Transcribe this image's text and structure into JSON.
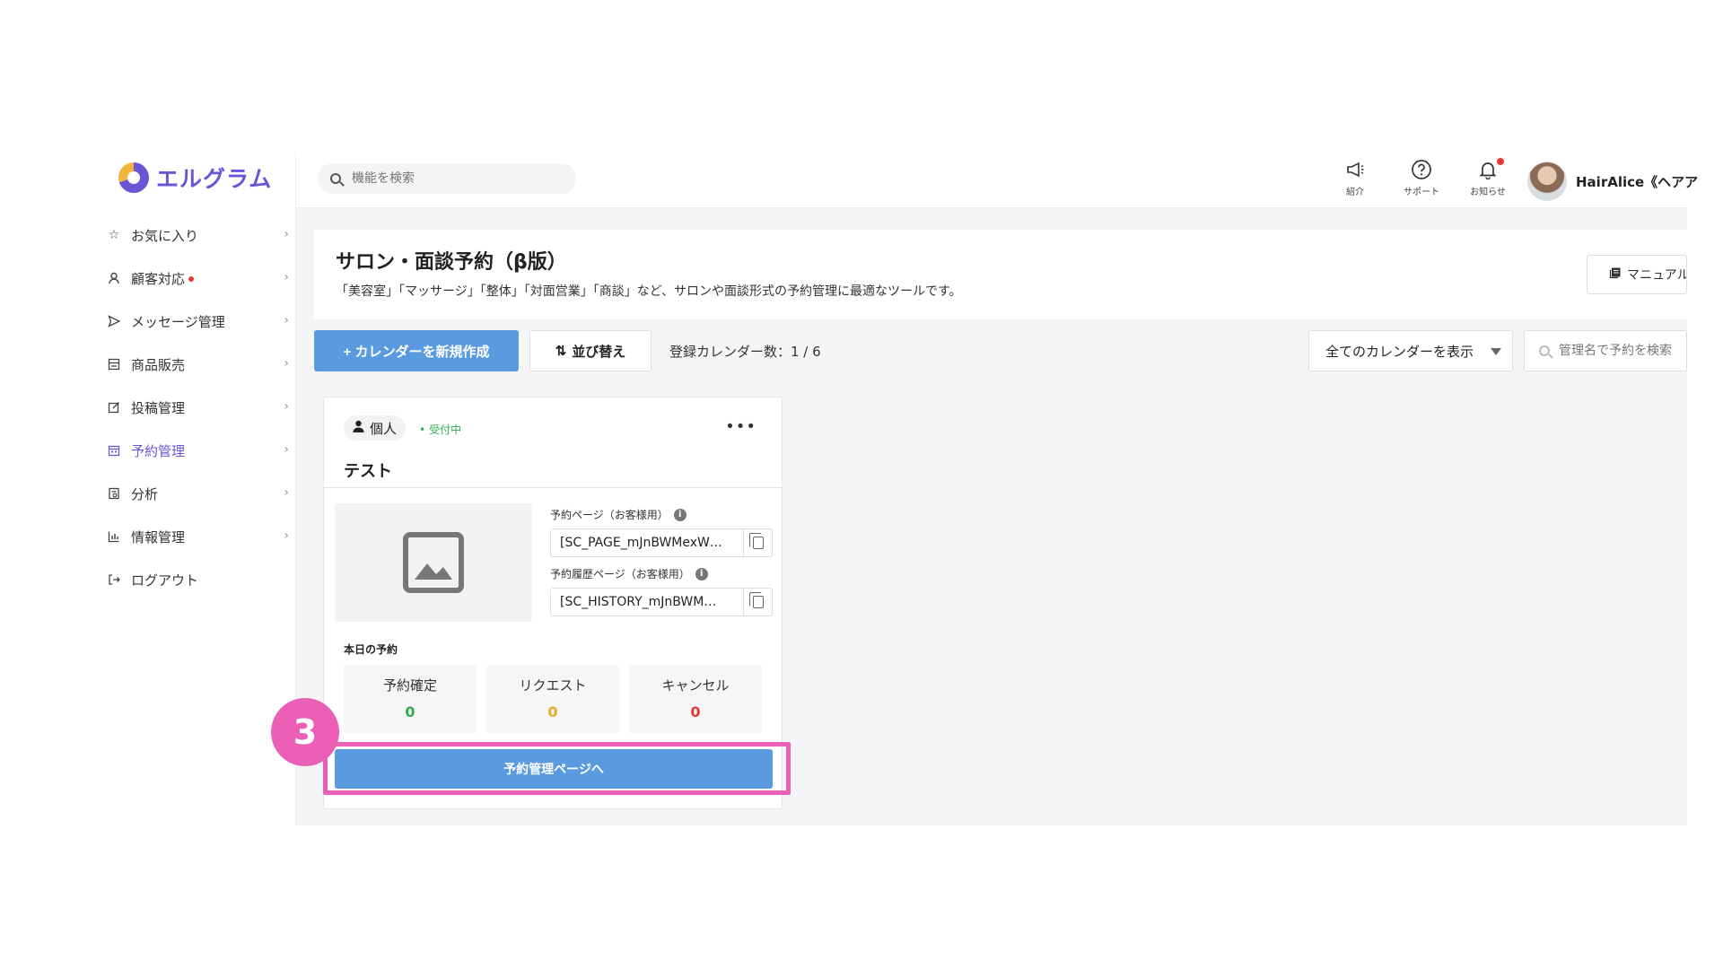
{
  "app": {
    "logo_text": "エルグラム"
  },
  "sidebar": {
    "items": [
      {
        "label": "お気に入り",
        "icon": "star-icon",
        "dot": false
      },
      {
        "label": "顧客対応",
        "icon": "person-icon",
        "dot": true
      },
      {
        "label": "メッセージ管理",
        "icon": "send-icon",
        "dot": false
      },
      {
        "label": "商品販売",
        "icon": "store-icon",
        "dot": false
      },
      {
        "label": "投稿管理",
        "icon": "edit-icon",
        "dot": false
      },
      {
        "label": "予約管理",
        "icon": "calendar-icon",
        "dot": false,
        "active": true
      },
      {
        "label": "分析",
        "icon": "report-icon",
        "dot": false
      },
      {
        "label": "情報管理",
        "icon": "chart-icon",
        "dot": false
      },
      {
        "label": "ログアウト",
        "icon": "logout-icon",
        "dot": false
      }
    ]
  },
  "topbar": {
    "search_placeholder": "機能を検索",
    "icons": [
      {
        "label": "紹介",
        "icon": "megaphone-icon"
      },
      {
        "label": "サポート",
        "icon": "help-icon"
      },
      {
        "label": "お知らせ",
        "icon": "bell-icon",
        "badge": true
      }
    ],
    "user_name": "HairAlice《ヘアア"
  },
  "page": {
    "title": "サロン・面談予約（β版）",
    "description": "「美容室」「マッサージ」「整体」「対面営業」「商談」など、サロンや面談形式の予約管理に最適なツールです。",
    "manual_label": "マニュアル"
  },
  "toolbar": {
    "new_calendar_label": "+ カレンダーを新規作成",
    "sort_label": "並び替え",
    "calendar_count": "登録カレンダー数：1 / 6",
    "filter_value": "全てのカレンダーを表示",
    "search_placeholder": "管理名で予約を検索"
  },
  "calendar_card": {
    "type_label": "個人",
    "status": "受付中",
    "title": "テスト",
    "booking_page_label": "予約ページ（お客様用）",
    "booking_page_value": "[SC_PAGE_mJnBWMexW…",
    "history_page_label": "予約履歴ページ（お客様用）",
    "history_page_value": "[SC_HISTORY_mJnBWM…",
    "today_label": "本日の予約",
    "stats": [
      {
        "label": "予約確定",
        "value": "0",
        "color": "#2eae4e"
      },
      {
        "label": "リクエスト",
        "value": "0",
        "color": "#e8a92b"
      },
      {
        "label": "キャンセル",
        "value": "0",
        "color": "#e53935"
      }
    ],
    "manage_button": "予約管理ページへ"
  },
  "annotation": {
    "step_number": "3",
    "color": "#ec5fb6"
  }
}
